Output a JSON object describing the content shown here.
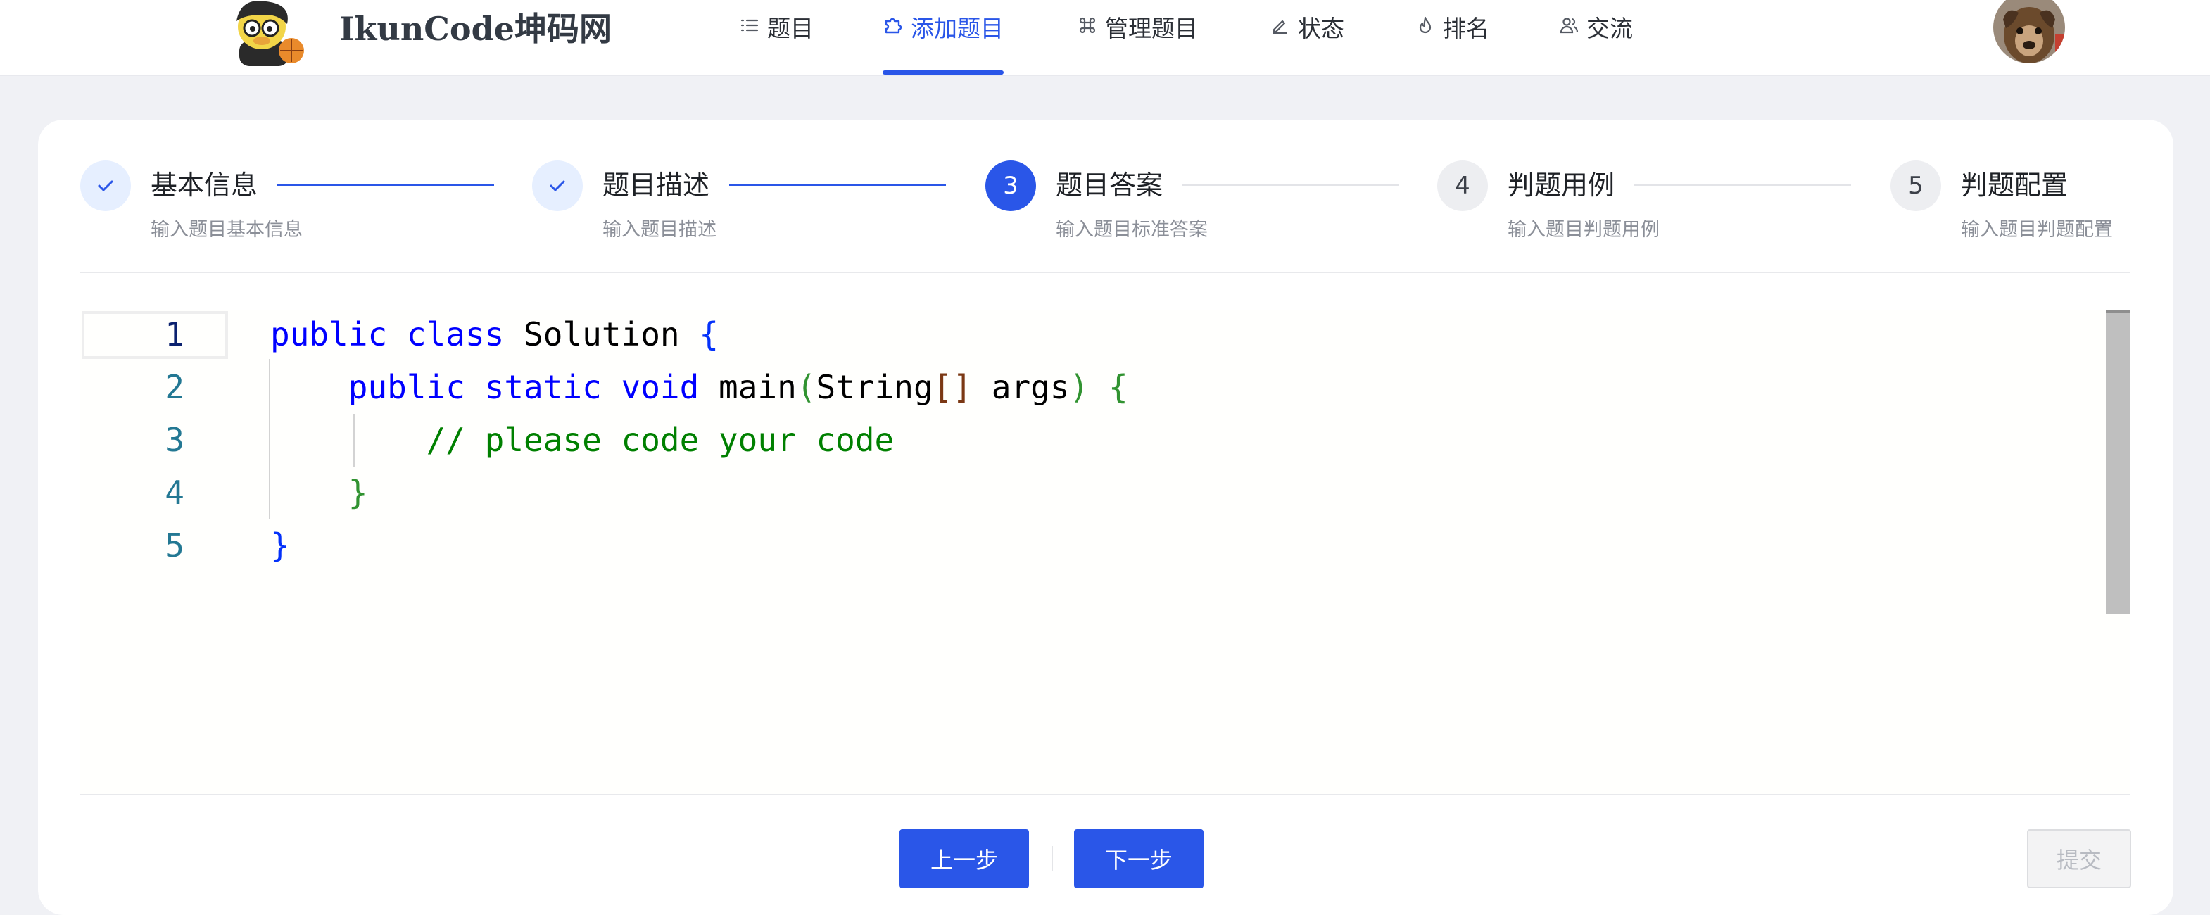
{
  "header": {
    "brand": "IkunCode坤码网",
    "nav": [
      {
        "label": "题目",
        "icon": "list-icon"
      },
      {
        "label": "添加题目",
        "icon": "puzzle-icon",
        "active": true
      },
      {
        "label": "管理题目",
        "icon": "command-icon"
      },
      {
        "label": "状态",
        "icon": "edit-icon"
      },
      {
        "label": "排名",
        "icon": "fire-icon"
      },
      {
        "label": "交流",
        "icon": "users-icon"
      }
    ]
  },
  "steps": [
    {
      "number": "1",
      "title": "基本信息",
      "description": "输入题目基本信息",
      "status": "done"
    },
    {
      "number": "2",
      "title": "题目描述",
      "description": "输入题目描述",
      "status": "done"
    },
    {
      "number": "3",
      "title": "题目答案",
      "description": "输入题目标准答案",
      "status": "current"
    },
    {
      "number": "4",
      "title": "判题用例",
      "description": "输入题目判题用例",
      "status": "pending"
    },
    {
      "number": "5",
      "title": "判题配置",
      "description": "输入题目判题配置",
      "status": "pending"
    }
  ],
  "editor": {
    "line_numbers": [
      "1",
      "2",
      "3",
      "4",
      "5"
    ],
    "current_line": "1",
    "code_lines": [
      "public class Solution {",
      "    public static void main(String[] args) {",
      "        // please code your code",
      "    }",
      "}"
    ]
  },
  "actions": {
    "prev_label": "上一步",
    "next_label": "下一步",
    "submit_label": "提交"
  },
  "colors": {
    "accent": "#2a56e8",
    "keyword": "#0000ff",
    "comment": "#008000",
    "line_number": "#237893"
  }
}
